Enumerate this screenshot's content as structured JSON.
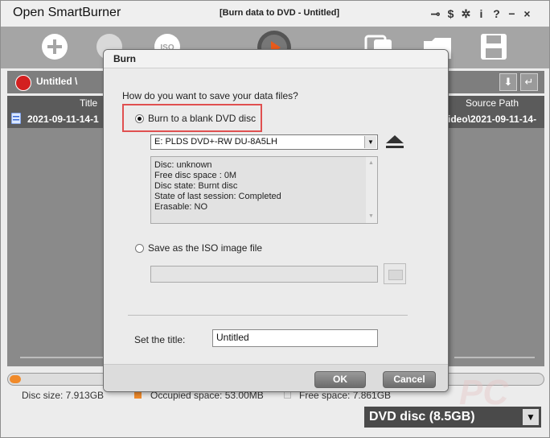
{
  "window": {
    "app_title": "Open SmartBurner",
    "doc_title": "[Burn data to DVD - Untitled]",
    "controls": [
      "⊸",
      "$",
      "✲",
      "i",
      "?",
      "−",
      "×"
    ]
  },
  "toolbar": {
    "watermark": "PC"
  },
  "project": {
    "name": "Untitled \\",
    "columns": {
      "title": "Title",
      "source": "Source Path"
    },
    "rows": [
      {
        "title": "2021-09-11-14-1",
        "source": "ideo\\2021-09-11-14-"
      }
    ]
  },
  "status": {
    "disc_size": "Disc size: 7.913GB",
    "occupied": "Occupied space: 53.00MB",
    "free": "Free space: 7.861GB",
    "disc_type": "DVD disc (8.5GB)",
    "colors": {
      "progress": "#f08a2a",
      "occupied": "#f08a2a",
      "free": "#cfcfcf"
    }
  },
  "dialog": {
    "title": "Burn",
    "question": "How do you want to save your data files?",
    "option_disc": "Burn to a blank DVD disc",
    "drive": "E: PLDS     DVD+-RW DU-8A5LH",
    "disc_info": [
      "Disc: unknown",
      "Free disc space : 0M",
      "Disc state: Burnt disc",
      "State of last session: Completed",
      "Erasable: NO"
    ],
    "option_iso": "Save as the ISO image file",
    "iso_path": "",
    "title_label": "Set the title:",
    "title_value": "Untitled",
    "ok": "OK",
    "cancel": "Cancel",
    "highlight_color": "#e05050"
  }
}
